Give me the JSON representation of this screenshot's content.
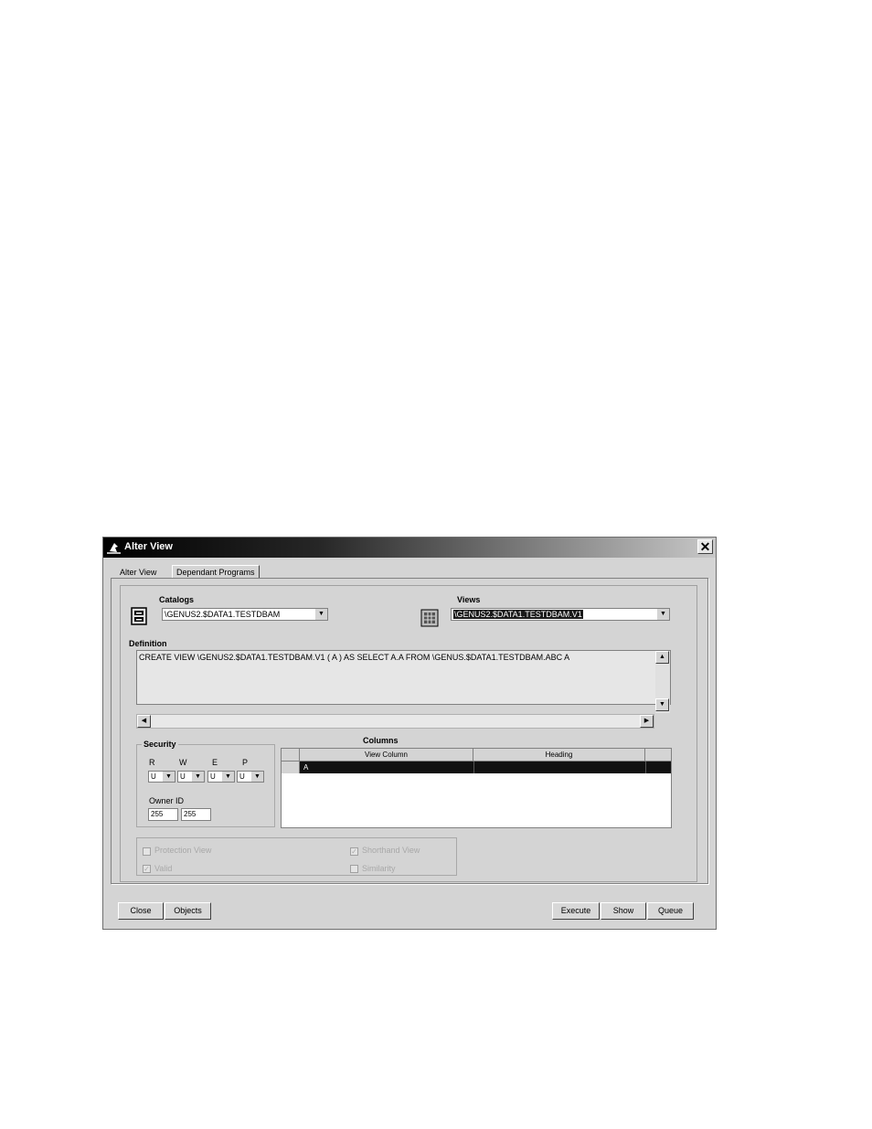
{
  "window": {
    "title": "Alter View",
    "close_symbol": "✕"
  },
  "tabs": [
    {
      "label": "Alter View",
      "active": true
    },
    {
      "label": "Dependant Programs",
      "active": false
    }
  ],
  "catalogs": {
    "label": "Catalogs",
    "value": "\\GENUS2.$DATA1.TESTDBAM",
    "icon": "catalog-icon"
  },
  "views": {
    "label": "Views",
    "value": "\\GENUS2.$DATA1.TESTDBAM.V1",
    "icon": "view-icon"
  },
  "definition": {
    "label": "Definition",
    "text": "CREATE VIEW \\GENUS2.$DATA1.TESTDBAM.V1 ( A ) AS SELECT A.A FROM \\GENUS.$DATA1.TESTDBAM.ABC A"
  },
  "security": {
    "label": "Security",
    "columns": [
      {
        "label": "R",
        "value": "U"
      },
      {
        "label": "W",
        "value": "U"
      },
      {
        "label": "E",
        "value": "U"
      },
      {
        "label": "P",
        "value": "U"
      }
    ],
    "owner_label": "Owner ID",
    "owner_group": "255",
    "owner_user": "255"
  },
  "columns": {
    "label": "Columns",
    "headers": [
      "View Column",
      "Heading"
    ],
    "rows": [
      {
        "view_column": "A",
        "heading": ""
      }
    ]
  },
  "options": [
    {
      "label": "Protection View",
      "checked": false
    },
    {
      "label": "Shorthand View",
      "checked": true
    },
    {
      "label": "Valid",
      "checked": true
    },
    {
      "label": "Similarity",
      "checked": false
    }
  ],
  "buttons": {
    "close": "Close",
    "objects": "Objects",
    "execute": "Execute",
    "show": "Show",
    "queue": "Queue"
  }
}
